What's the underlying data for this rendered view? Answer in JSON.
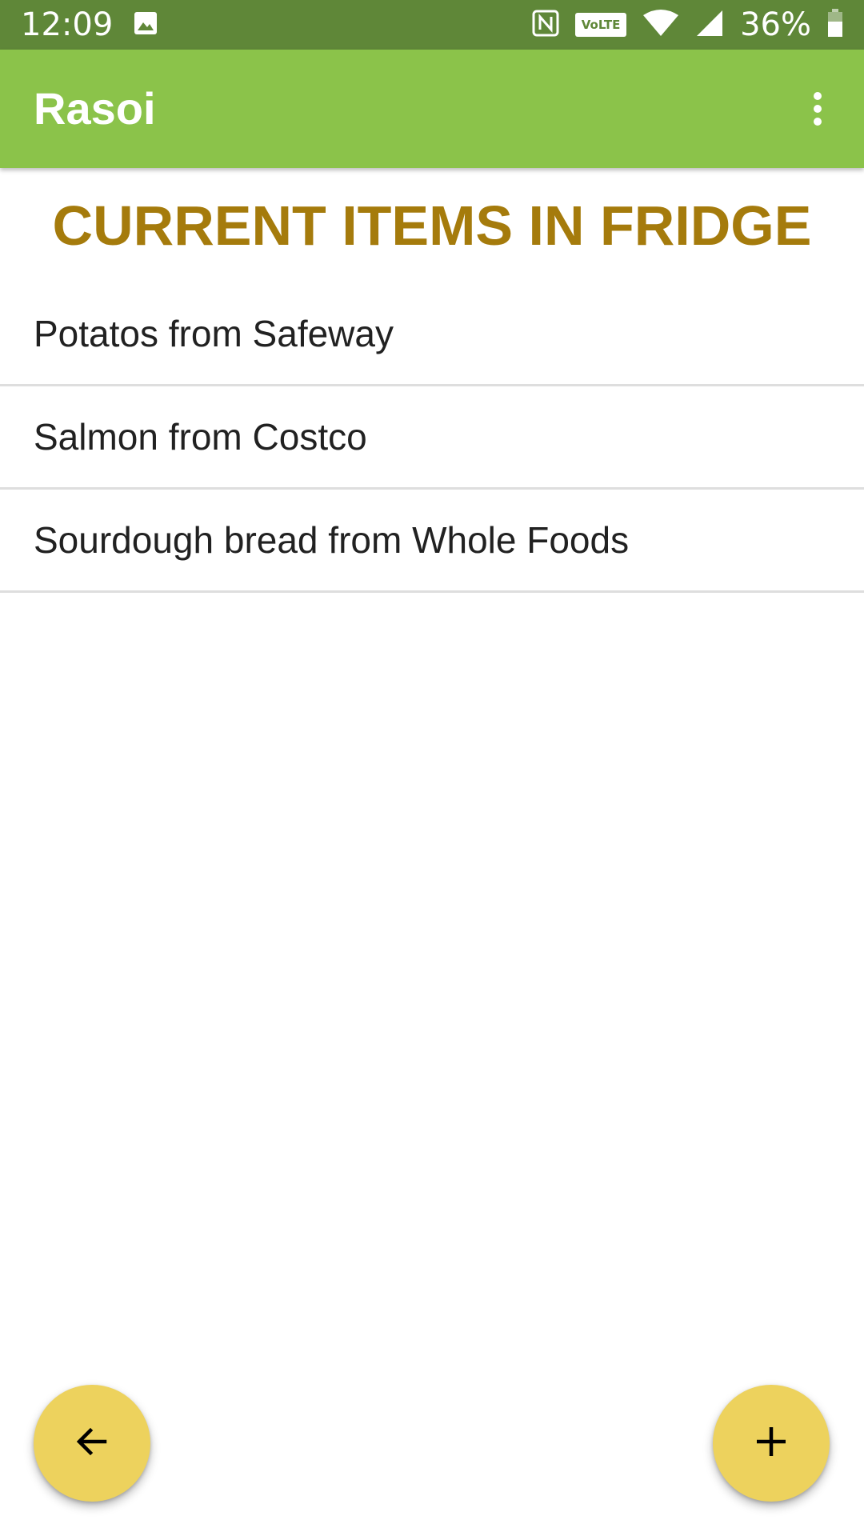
{
  "status_bar": {
    "time": "12:09",
    "battery_percent": "36%",
    "volte_label": "VoLTE",
    "icons": [
      "image-icon",
      "nfc-icon",
      "volte-icon",
      "wifi-icon",
      "cellular-signal-icon",
      "battery-icon"
    ]
  },
  "app_bar": {
    "title": "Rasoi",
    "menu_icon": "more-vertical-icon"
  },
  "main": {
    "heading": "CURRENT ITEMS IN FRIDGE",
    "items": [
      {
        "label": "Potatos from Safeway"
      },
      {
        "label": "Salmon from Costco"
      },
      {
        "label": "Sourdough bread from Whole Foods"
      }
    ]
  },
  "fabs": {
    "back_icon": "arrow-left-icon",
    "add_icon": "plus-icon"
  },
  "colors": {
    "status_bar": "#5f8738",
    "app_bar": "#8bc34a",
    "heading": "#a57b0c",
    "fab": "#edd25d",
    "divider": "#dedede"
  }
}
